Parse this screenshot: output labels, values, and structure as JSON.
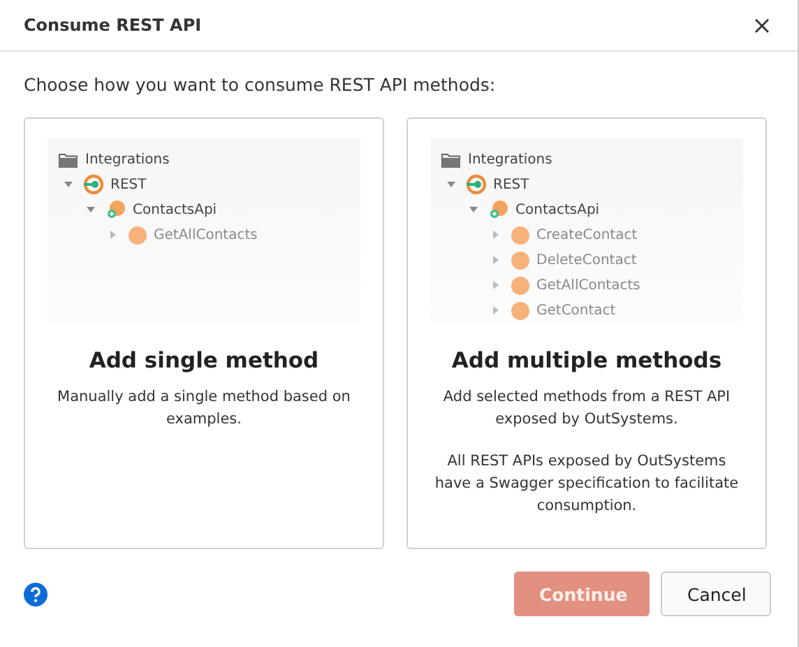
{
  "window": {
    "title": "Consume REST API"
  },
  "prompt": "Choose how you want to consume REST API methods:",
  "options": [
    {
      "tree": [
        {
          "label": "Integrations",
          "kind": "folder",
          "children": [
            {
              "label": "REST",
              "kind": "rest",
              "expanded": true,
              "children": [
                {
                  "label": "ContactsApi",
                  "kind": "api",
                  "expanded": true,
                  "children": [
                    {
                      "label": "GetAllContacts",
                      "kind": "method",
                      "expanded": false
                    }
                  ]
                }
              ]
            }
          ]
        }
      ],
      "title": "Add single method",
      "paragraphs": [
        "Manually add a single method based on examples."
      ],
      "selected": false
    },
    {
      "tree": [
        {
          "label": "Integrations",
          "kind": "folder",
          "children": [
            {
              "label": "REST",
              "kind": "rest",
              "expanded": true,
              "children": [
                {
                  "label": "ContactsApi",
                  "kind": "api",
                  "expanded": true,
                  "children": [
                    {
                      "label": "CreateContact",
                      "kind": "method",
                      "expanded": false
                    },
                    {
                      "label": "DeleteContact",
                      "kind": "method",
                      "expanded": false
                    },
                    {
                      "label": "GetAllContacts",
                      "kind": "method",
                      "expanded": false
                    },
                    {
                      "label": "GetContact",
                      "kind": "method",
                      "expanded": false
                    }
                  ]
                }
              ]
            }
          ]
        }
      ],
      "title": "Add multiple methods",
      "paragraphs": [
        "Add selected methods from a REST API exposed by OutSystems.",
        "All REST APIs exposed by OutSystems have a Swagger specification to facilitate consumption."
      ],
      "selected": false
    }
  ],
  "buttons": [
    {
      "label": "Continue",
      "kind": "primary",
      "disabled": true
    },
    {
      "label": "Cancel",
      "kind": "secondary",
      "disabled": false
    }
  ]
}
